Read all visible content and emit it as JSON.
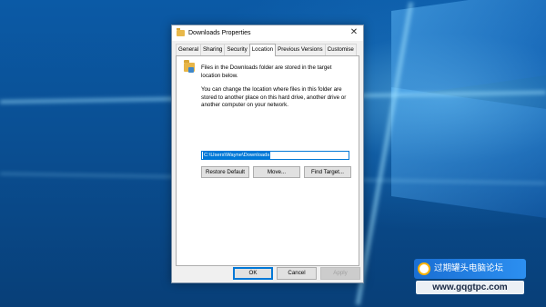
{
  "dialog": {
    "title": "Downloads Properties",
    "close_glyph": "✕",
    "tabs": [
      "General",
      "Sharing",
      "Security",
      "Location",
      "Previous Versions",
      "Customise"
    ],
    "active_tab": "Location",
    "intro_text": "Files in the Downloads folder are stored in the target location below.",
    "description": "You can change the location where files in this folder are stored to another place on this hard drive, another drive or another computer on your network.",
    "path_value": "C:\\Users\\Wayne\\Downloads",
    "buttons": {
      "restore_default": "Restore Default",
      "move": "Move...",
      "find_target": "Find Target..."
    },
    "footer": {
      "ok": "OK",
      "cancel": "Cancel",
      "apply": "Apply"
    }
  },
  "watermark": {
    "top_text": "过期罐头电脑论坛",
    "bottom_text": "www.gqgtpc.com"
  },
  "colors": {
    "desktop_blue": "#0a4f92",
    "accent": "#0078d7",
    "folder": "#e7b547"
  },
  "icons": {
    "title": "folder-download-icon",
    "panel": "folder-download-icon",
    "close": "close-icon",
    "watermark": "forum-logo-icon"
  }
}
